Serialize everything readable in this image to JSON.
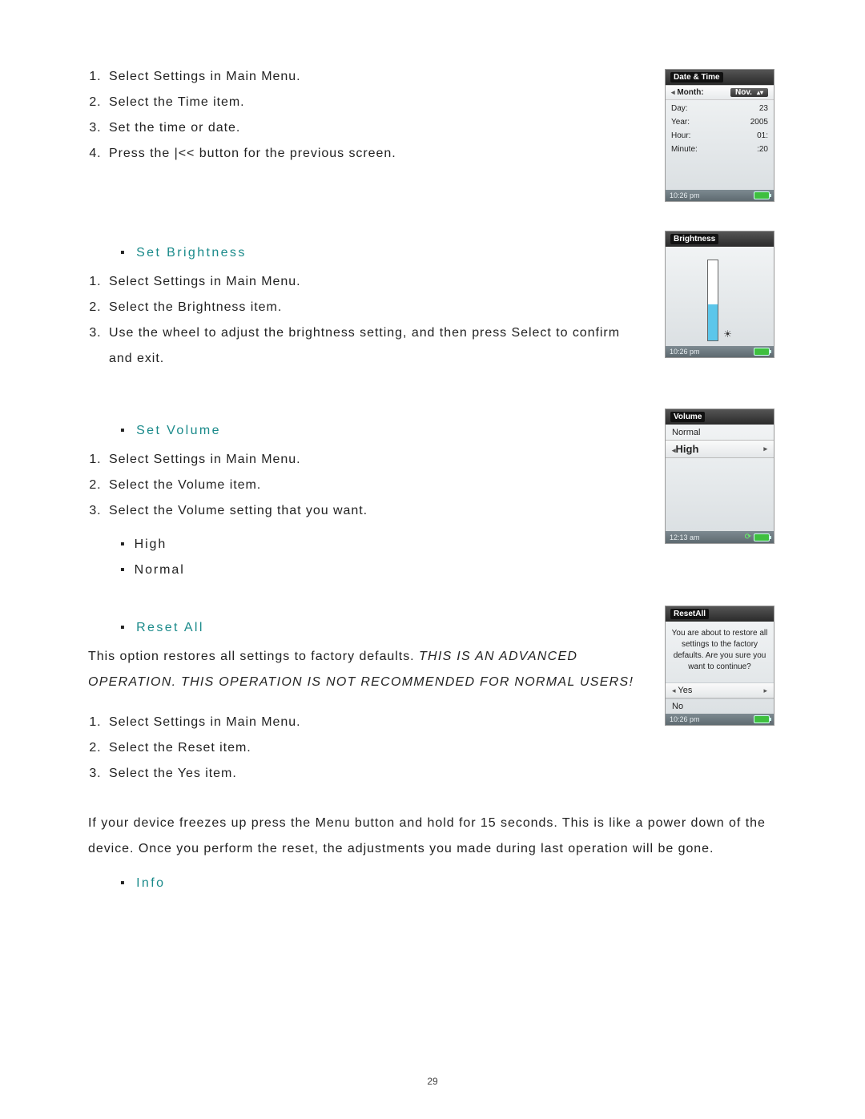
{
  "page_number": "29",
  "sections": {
    "set_time": {
      "steps": [
        "Select Settings in Main Menu.",
        "Select the Time item.",
        "Set the time or date.",
        "Press the |<< button for the previous screen."
      ]
    },
    "set_brightness": {
      "heading": "Set Brightness",
      "steps": [
        "Select Settings in Main Menu.",
        "Select the Brightness item.",
        "Use the wheel to adjust the brightness setting, and then press Select to confirm and exit."
      ]
    },
    "set_volume": {
      "heading": "Set Volume",
      "steps": [
        "Select Settings in Main Menu.",
        "Select the Volume item.",
        "Select the Volume setting that you want."
      ],
      "options": [
        "High",
        "Normal"
      ]
    },
    "reset_all": {
      "heading": "Reset All",
      "intro": "This option restores all settings to factory defaults. ",
      "warning": "THIS IS AN ADVANCED OPERATION. THIS OPERATION IS NOT RECOMMENDED FOR NORMAL USERS!",
      "steps": [
        "Select Settings in Main Menu.",
        "Select the Reset item.",
        "Select the Yes item."
      ],
      "freeze_note": "If your device freezes up press the Menu button and hold for 15 seconds. This is like a power down of the device. Once you perform the reset, the adjustments you made during last operation will be gone."
    },
    "info": {
      "heading": "Info"
    }
  },
  "screenshots": {
    "date_time": {
      "title": "Date & Time",
      "selected_field_label": "Month:",
      "selected_field_value": "Nov.",
      "rows": [
        {
          "label": "Day:",
          "value": "23"
        },
        {
          "label": "Year:",
          "value": "2005"
        },
        {
          "label": "Hour:",
          "value": "01:"
        },
        {
          "label": "Minute:",
          "value": ":20"
        }
      ],
      "status_time": "10:26 pm"
    },
    "brightness": {
      "title": "Brightness",
      "level_percent": 45,
      "status_time": "10:26 pm"
    },
    "volume": {
      "title": "Volume",
      "items": [
        "Normal"
      ],
      "selected": "High",
      "status_time": "12:13 am"
    },
    "reset": {
      "title": "ResetAll",
      "message": "You are about to restore all settings to the factory defaults. Are you sure you want to continue?",
      "yes": "Yes",
      "no": "No",
      "status_time": "10:26 pm"
    }
  }
}
